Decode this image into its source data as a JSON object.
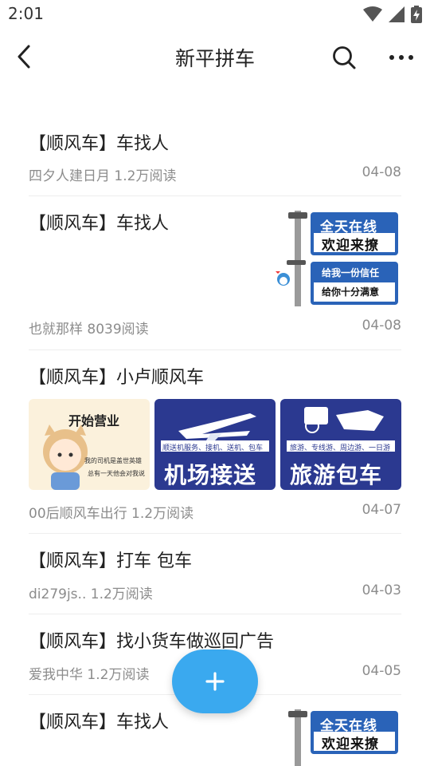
{
  "status": {
    "time": "2:01"
  },
  "nav": {
    "title": "新平拼车"
  },
  "posts": [
    {
      "title": "【顺风车】车找人",
      "meta": "四夕人建日月 1.2万阅读",
      "date": "04-08"
    },
    {
      "title": "【顺风车】车找人",
      "meta": "也就那样 8039阅读",
      "date": "04-08",
      "image": {
        "line1": "全天在线",
        "line2": "欢迎来撩",
        "line3": "给我一份信任",
        "line4": "给你十分满意"
      }
    },
    {
      "title": "【顺风车】小卢顺风车",
      "meta": "00后顺风车出行 1.2万阅读",
      "date": "04-07",
      "images": [
        {
          "caption": "开始营业",
          "small1": "我的司机是盖世英雄",
          "small2": "总有一天他会对我说"
        },
        {
          "caption": "机场接送",
          "sub": "顺送机服务、接机、送机、包车"
        },
        {
          "caption": "旅游包车",
          "sub": "旅游、专线游、周边游、一日游"
        }
      ]
    },
    {
      "title": "【顺风车】打车 包车",
      "meta": "di279js.. 1.2万阅读",
      "date": "04-03"
    },
    {
      "title": "【顺风车】找小货车做巡回广告",
      "meta": "爱我中华 1.2万阅读",
      "date": "04-05"
    },
    {
      "title": "【顺风车】车找人",
      "image": {
        "line1": "全天在线",
        "line2": "欢迎来撩"
      }
    }
  ],
  "colors": {
    "accent": "#3aa9ef",
    "sign_blue": "#2a63b8",
    "poster_blue": "#2b3990"
  }
}
